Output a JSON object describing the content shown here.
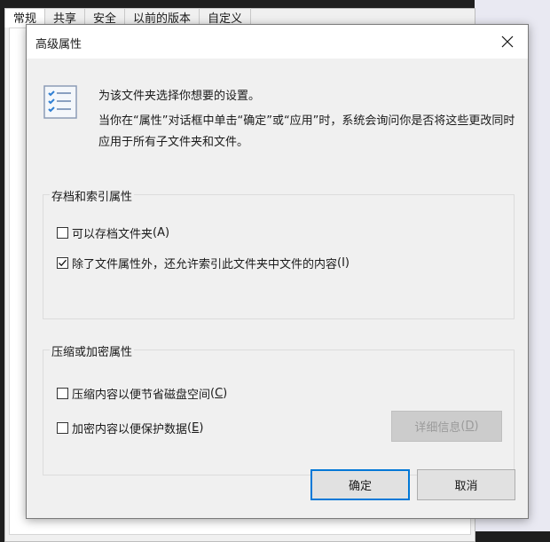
{
  "background": {
    "tabs": [
      "常规",
      "共享",
      "安全",
      "以前的版本",
      "自定义"
    ]
  },
  "dialog": {
    "title": "高级属性",
    "close_icon": "close-icon",
    "description_line1": "为该文件夹选择你想要的设置。",
    "description_line2": "当你在“属性”对话框中单击“确定”或“应用”时，系统会询问你是否将这些更改同时应用于所有子文件夹和文件。",
    "archive_group": {
      "label": "存档和索引属性",
      "options": [
        {
          "text": "可以存档文件夹",
          "accel": "(A)",
          "checked": false
        },
        {
          "text": "除了文件属性外，还允许索引此文件夹中文件的内容",
          "accel": "(I)",
          "checked": true
        }
      ]
    },
    "compress_group": {
      "label": "压缩或加密属性",
      "options": [
        {
          "text": "压缩内容以便节省磁盘空间",
          "accel_pre": "(",
          "accel_key": "C",
          "accel_post": ")",
          "checked": false
        },
        {
          "text": "加密内容以便保护数据",
          "accel_pre": "(",
          "accel_key": "E",
          "accel_post": ")",
          "checked": false
        }
      ],
      "details_button": {
        "text": "详细信息",
        "accel_pre": "(",
        "accel_key": "D",
        "accel_post": ")"
      }
    },
    "ok_label": "确定",
    "cancel_label": "取消"
  }
}
